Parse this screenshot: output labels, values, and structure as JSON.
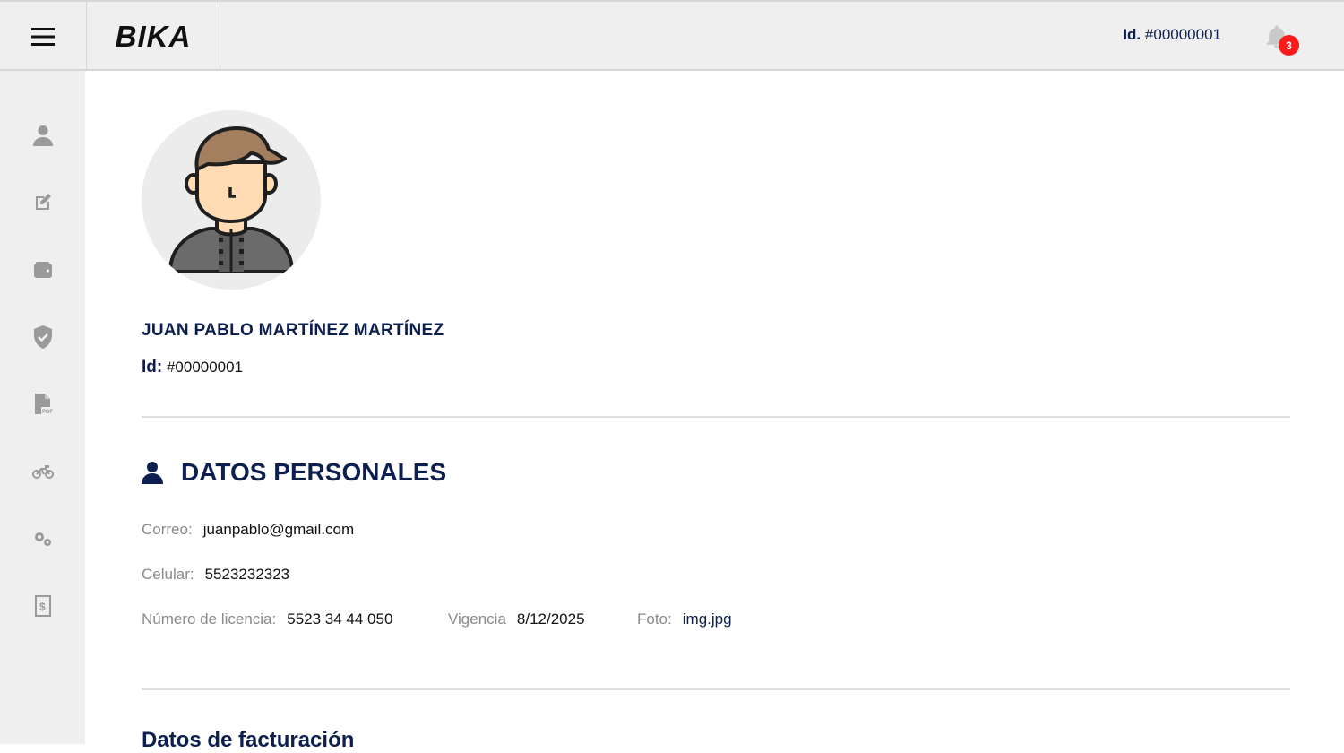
{
  "header": {
    "logo": "BIKA",
    "id_label": "Id.",
    "id_value": "#00000001",
    "notification_count": "3"
  },
  "sidebar": {
    "items": [
      {
        "icon": "user-icon"
      },
      {
        "icon": "edit-icon"
      },
      {
        "icon": "wallet-icon"
      },
      {
        "icon": "shield-check-icon"
      },
      {
        "icon": "pdf-file-icon"
      },
      {
        "icon": "motorcycle-icon"
      },
      {
        "icon": "gears-icon"
      },
      {
        "icon": "receipt-icon"
      }
    ]
  },
  "profile": {
    "name": "JUAN PABLO MARTÍNEZ MARTÍNEZ",
    "id_label": "Id:",
    "id_value": "#00000001"
  },
  "personal": {
    "title": "DATOS PERSONALES",
    "email_label": "Correo:",
    "email_value": "juanpablo@gmail.com",
    "phone_label": "Celular:",
    "phone_value": "5523232323",
    "license_label": "Número de licencia:",
    "license_value": "5523 34 44 050",
    "validity_label": "Vigencia",
    "validity_value": "8/12/2025",
    "photo_label": "Foto:",
    "photo_value": "img.jpg"
  },
  "billing": {
    "title": "Datos de facturación"
  },
  "colors": {
    "navy": "#0d1f4f",
    "badge": "#ff1a1a",
    "icon_gray": "#9a9a9a"
  }
}
